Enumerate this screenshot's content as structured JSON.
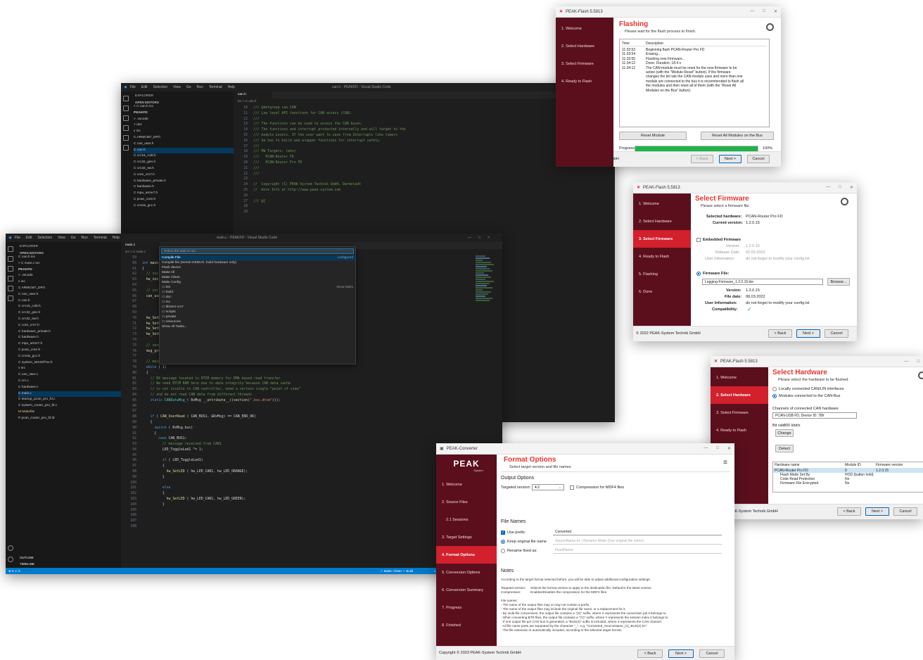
{
  "colors": {
    "peak_red": "#d2202d",
    "peak_sidebar": "#5b0f1d",
    "vscode_bg": "#1e1e1e",
    "vscode_status": "#007acc",
    "progress_green": "#21b24a"
  },
  "flash_window": {
    "title": "PEAK-Flash 5.5813",
    "steps": [
      "1. Welcome",
      "2. Select Hardware",
      "3. Select Firmware",
      "4. Ready to Flash"
    ],
    "heading": "Flashing",
    "subtitle": "Please wait for the flash process to finish.",
    "log_headers": [
      "Time",
      "Description"
    ],
    "log": [
      {
        "time": "11:33:53",
        "desc": "Beginning flash PCAN-Router Pro FD"
      },
      {
        "time": "11:33:54",
        "desc": "Erasing..."
      },
      {
        "time": "11:33:55",
        "desc": "Flashing new Firmware..."
      },
      {
        "time": "11:34:12",
        "desc": "Done. Duration: 18.4 s"
      },
      {
        "time": "11:34:12",
        "desc": "The CAN-module must be reset for the new firmware to be active (with the \"Module Reset\" button). If the firmware changes the bit rate the CAN-module uses and more than one module are connected to the bus it is recommended to flash all the modules and then reset all of them (with the \"Reset All Modules on the Bus\" button)."
      }
    ],
    "reset_module": "Reset Module",
    "reset_all": "Reset All Modules on the Bus",
    "progress_label": "Progress:",
    "progress": 1.0,
    "progress_text": "100%",
    "copyright": "GmbH",
    "back": "< Back",
    "next": "Next >",
    "cancel": "Cancel"
  },
  "firmware_window": {
    "title": "PEAK-Flash 5.5813",
    "steps": [
      "1. Welcome",
      "2. Select Hardware",
      "3. Select Firmware",
      "4. Ready to Flash",
      "5. Flashing",
      "6. Done"
    ],
    "heading": "Select Firmware",
    "subtitle": "Please select a firmware file.",
    "selected_hw_label": "Selected hardware:",
    "selected_hw": "PCAN-Router Pro FD",
    "current_version_label": "Current version:",
    "current_version": "1.2.0.15",
    "embedded_label": "Embedded Firmware",
    "emb_version_label": "Version:",
    "emb_version": "1.2.0.15",
    "emb_date_label": "Release Date:",
    "emb_date": "02.03.2022",
    "emb_info_label": "User Information:",
    "emb_info": "do not forget to modify your config.txt",
    "file_label": "Firmware File:",
    "file_value": "Logging-Firmware_1.2.0.15.bin",
    "browse": "Browse...",
    "file_version_label": "Version:",
    "file_version": "1.2.0.15",
    "file_date_label": "File date:",
    "file_date": "08.03.2022",
    "file_info_label": "User Information:",
    "file_info": "do not forget to modify your config.txt",
    "compat_label": "Compatibility:",
    "copyright": "© 2022 PEAK-System Technik GmbH",
    "back": "< Back",
    "next": "Next >",
    "cancel": "Cancel"
  },
  "hardware_window": {
    "title": "PEAK-Flash 5.5813",
    "steps": [
      "1. Welcome",
      "2. Select Hardware",
      "3. Select Firmware",
      "4. Ready to Flash"
    ],
    "heading": "Select Hardware",
    "subtitle": "Please select the hardware to be flashed.",
    "opt_local": "Locally connected CAN/LIN interfaces",
    "opt_modules": "Modules connected to the CAN-Bus",
    "channels_label": "Channels of connected CAN hardware",
    "channel_value": "PCAN-USB FD, Device ID: 78h",
    "bitrate_label": "Bit rate:",
    "bitrate_value": "500 kbit/s",
    "change": "Change",
    "detect": "Detect",
    "table_headers": [
      "Hardware name",
      "Module ID",
      "Firmware version"
    ],
    "rows": [
      {
        "name": "PCAN-Router Pro FD",
        "id": "0",
        "fw": "1.2.0.15"
      },
      {
        "name": "Flash Mode Set By",
        "id": "HOD (button hold)",
        "fw": ""
      },
      {
        "name": "Code Read Protection",
        "id": "No",
        "fw": ""
      },
      {
        "name": "Firmware File Encrypted",
        "id": "No",
        "fw": ""
      }
    ],
    "copyright": "© 2022 PEAK-System Technik GmbH",
    "back": "< Back",
    "next": "Next >",
    "cancel": "Cancel"
  },
  "converter_window": {
    "title": "PEAK-Converter",
    "logo": "PEAK",
    "logo_sub": "System",
    "steps": [
      "1. Welcome",
      "2. Source Files",
      "2.1 Sessions",
      "3. Target Settings",
      "4. Format Options",
      "5. Conversion Options",
      "6. Conversion Summary",
      "7. Progress",
      "8. Finished"
    ],
    "heading": "Format Options",
    "subtitle": "Select target version and file names.",
    "output_title": "Output Options",
    "targeted_version_label": "Targeted version:",
    "targeted_version": "4.2",
    "compression_label": "Compression for MDF4 files",
    "file_names_title": "File Names",
    "use_prefix": "Use prefix:",
    "prefix_value": "Converted",
    "keep_original": "Keep original file name",
    "keep_placeholder": "SourceName.trc | Rename Mode (Use original file name)",
    "rename_fixed": "Rename fixed as:",
    "rename_value": "FixedName",
    "notes_title": "Notes",
    "notes_intro": "According to the target format selected before, you will be able to adjust additional configuration settings:",
    "notes_tv_label": "Targeted version:",
    "notes_tv": "Selects the format version to apply to the destination file. Default is the latest version.",
    "notes_comp_label": "Compression:",
    "notes_comp": "Enables/Disables the compression for the MDF4 files",
    "notes_list": [
      "File names:",
      "- The name of the output files may or may not contain a prefix.",
      "- The name of the output files may include the original file name, or a replacement for it.",
      "- By multi-file conversions, the output file contains a \"(X)\" suffix, where X represents the conversion job it belongs to.",
      "- When converting BTR files, the output file contains a \"(Y)\" suffix, where Y represents the session index it belongs to.",
      "- If one output file per CAN bus is generated, a \"BUS(Z)\" suffix is included, where Z represents the CAN channel.",
      "- All file name parts are separated by the character \"_\", e.g. \"Converted_SourceName_(1)_BUS(1).trc\"",
      "- The file extension is automatically included, according to the selected target format."
    ],
    "copyright": "Copyright © 2023 PEAK-System Technik GmbH",
    "back": "< Back",
    "next": "Next >",
    "cancel": "Cancel"
  },
  "vscode_back": {
    "title": "can.h - PEAKFD - Visual Studio Code",
    "menu": [
      "File",
      "Edit",
      "Selection",
      "View",
      "Go",
      "Run",
      "Terminal",
      "Help"
    ],
    "explorer_label": "EXPLORER",
    "open_editors": "OPEN EDITORS",
    "tab": "can.h",
    "breadcrumb": "inc > C can.h",
    "tree": [
      "× C can.h inc",
      "PEAKFD",
      "> .vscode",
      "> doc",
      "v inc",
      "C ARMCM7_DP.h",
      "C can_user.h",
      "C can.h",
      "C crc16_ccitt.h",
      "C crc32_gen.h",
      "C crc32_sw.h",
      "C core_cm7.h",
      "C hardware_private.h",
      "C hardware.h",
      "C mpu_armv7.h",
      "C pcan_core.h",
      "C cmsis_gcc.h"
    ],
    "line_numbers": [
      "10",
      "11",
      "12",
      "13",
      "14",
      "15",
      "16",
      "17",
      "18",
      "19",
      "20",
      "21",
      "22",
      "23",
      "24",
      "25",
      "26",
      "27",
      "28",
      "29"
    ],
    "code": [
      "/// @defgroup can CAN",
      "/// Low level API functions for CAN access (CAN).",
      "///",
      "/// The functions can be used to access the CAN buses.",
      "/// The functions and interrupt protected internally and will target to the",
      "/// module Levels. If the user want to save from Interrupts like timers",
      "/// be has to build and wrapper functions for interrupt safety.",
      "///",
      "/// HW Targets: (who)",
      "///   PCAN-Router FD",
      "///   PCAN-Router Pro FD",
      "///",
      "///",
      "",
      "//  Copyright (C) PEAK-System Technik GmbH, Darmstadt",
      "//  more Info at http://www.peak-system.com",
      "",
      "/// @{",
      "",
      ""
    ]
  },
  "vscode_front": {
    "title": "main.c - PEAKFD - Visual Studio Code",
    "menu": [
      "File",
      "Edit",
      "Selection",
      "View",
      "Go",
      "Run",
      "Terminal",
      "Help"
    ],
    "explorer_label": "EXPLORER",
    "open_editors": "OPEN EDITORS",
    "tab": "main.c",
    "breadcrumb": "src > C main.c",
    "tree": [
      "C can.h inc",
      "× C main.c src",
      "PEAKFD",
      "> .vscode",
      "v inc",
      "C ARMCM7_DP.h",
      "C can_user.h",
      "C can.h",
      "C crc16_ccitt.h",
      "C crc32_gen.h",
      "C crc32_sw.h",
      "C core_cm7.h",
      "C hardware_private.h",
      "C hardware.h",
      "C mpu_armv7.h",
      "C pcan_core.h",
      "C cmsis_gcc.h",
      "C system_stm32f7xx.h",
      "v src",
      "C can_user.c",
      "C crc.c",
      "C hardware.c",
      "C main.c",
      "C startup_pcan_pro_fd.c",
      "C system_router_pro_fd.c",
      "M Makefile",
      "P pcan_router_pro_fd.ld"
    ],
    "outline": "OUTLINE",
    "timeline": "TIMELINE",
    "qp_placeholder": "Select the task to run",
    "qp_items": [
      {
        "label": "Compile File",
        "right": "configured"
      },
      {
        "label": "Compile file (MAKE-DEBUG: build hardware only)",
        "right": ""
      },
      {
        "label": "Flash device",
        "right": ""
      },
      {
        "label": "Make All",
        "right": ""
      },
      {
        "label": "Make Clean",
        "right": ""
      },
      {
        "label": "Make Config",
        "right": ""
      },
      {
        "label": "bin",
        "right": "show tasks"
      },
      {
        "label": "build",
        "right": ""
      },
      {
        "label": "doc",
        "right": ""
      },
      {
        "label": "inc",
        "right": ""
      },
      {
        "label": "lib/arm-cm7",
        "right": ""
      },
      {
        "label": "scripts",
        "right": ""
      },
      {
        "label": "private",
        "right": ""
      },
      {
        "label": "resources",
        "right": ""
      },
      {
        "label": "Show All Tasks...",
        "right": ""
      }
    ],
    "line_numbers": [
      "59",
      "60",
      "61",
      "62",
      "63",
      "64",
      "65",
      "66",
      "67",
      "68",
      "69",
      "70",
      "71",
      "72",
      "73",
      "74",
      "75",
      "76",
      "77",
      "78",
      "79",
      "80",
      "81",
      "82",
      "83",
      "84",
      "85",
      "86",
      "87",
      "88",
      "89",
      "90",
      "91",
      "92",
      "93",
      "94",
      "95",
      "96",
      "97",
      "98",
      "99",
      "100",
      "101",
      "102",
      "103",
      "104",
      "105",
      "106",
      "107",
      "108"
    ],
    "code": [
      "",
      "int main ( void)",
      "{",
      "  // init hardware",
      "  hw_init();",
      "",
      "  // init CAN",
      "  can_user_init();",
      "",
      "",
      "",
      "  hw_SetLED ( hw_LED_CAN1, hw_LED_GREEN);",
      "  hw_SetLED ( hw_LED_CAN2, hw_LED_GREEN);",
      "  hw_SetLED ( hw_LED_CAN3, hw_LED_GREEN);",
      "  hw_SetLED ( hw_LED_CAN4, hw_LED_GREEN);",
      "",
      "  // send the greeting message",
      "  msg_greeting();",
      "",
      "  // main loop",
      "  while ( 1)",
      "  {",
      "    // RX message located in DTCM memory for DMA based read transfer",
      "    // We need DTCM RAM here due to data integrity because CAN data cache",
      "    // is not visible to CAN controller, need a certain single \"point of view\"",
      "    // and do not read CAN data from different threads",
      "    static CANDataMsg_t RxMsg __attribute__((section(\".bss.dtcm\")));",
      "",
      "",
      "    if ( CAN_UserRead ( CAN_BUS1, &RxMsg) == CAN_ERR_OK)",
      "    {",
      "      switch ( RxMsg.bus)",
      "      {",
      "        case CAN_BUS1:",
      "          // message received from CAN1",
      "          LED_ToggleLed1 ^= 1;",
      "",
      "          if ( LED_ToggleLed1)",
      "          {",
      "            hw_SetLED ( hw_LED_CAN1, hw_LED_ORANGE);",
      "          }",
      "",
      "          else",
      "          {",
      "            hw_SetLED ( hw_LED_CAN1, hw_LED_GREEN);",
      "          }",
      "",
      "",
      "",
      ""
    ],
    "status_right": "Ln 1, Col 1   Spaces: 4   UTF-8   CRLF   {} C   Win32",
    "status_mid": "✓ Make: Clean   ✓ Build",
    "status_left": "⊗ 0 ⚠ 0"
  }
}
